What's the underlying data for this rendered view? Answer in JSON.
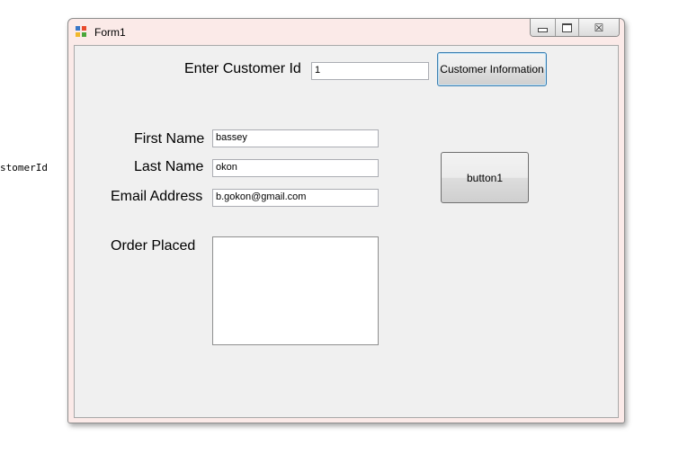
{
  "background_code": {
    "text": "stomerId"
  },
  "window": {
    "title": "Form1",
    "icon": "form-app-icon",
    "caption_buttons": {
      "minimize_icon": "minimize-icon",
      "maximize_icon": "maximize-icon",
      "close_symbol": "☒"
    }
  },
  "form": {
    "customer_id_label": "Enter Customer Id",
    "customer_id_value": "1",
    "customer_info_button": "Customer Information",
    "first_name_label": "First Name",
    "first_name_value": "bassey",
    "last_name_label": "Last Name",
    "last_name_value": "okon",
    "email_label": "Email Address",
    "email_value": "b.gokon@gmail.com",
    "order_label": "Order Placed",
    "order_value": "",
    "button1_label": "button1"
  },
  "colors": {
    "window_frame": "#fbeae8",
    "client_area": "#f0f0f0",
    "focus_border": "#3c7fb1"
  }
}
